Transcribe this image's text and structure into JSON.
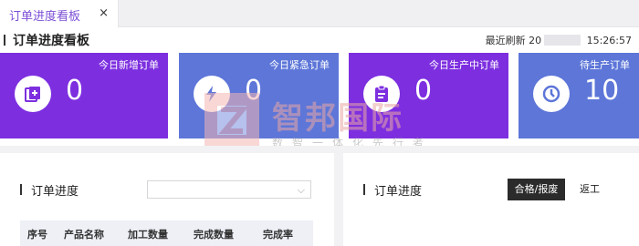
{
  "tab": {
    "label": "订单进度看板",
    "close": "×"
  },
  "header": {
    "title": "订单进度看板",
    "refresh_label": "最近刷新",
    "refresh_date_prefix": "20",
    "refresh_time": "15:26:57"
  },
  "kpis": [
    {
      "label": "今日新增订单",
      "value": "0",
      "icon": "add-document-icon",
      "color": "#7d2fe0"
    },
    {
      "label": "今日紧急订单",
      "value": "0",
      "icon": "lightning-icon",
      "color": "#5d76d8"
    },
    {
      "label": "今日生产中订单",
      "value": "0",
      "icon": "clipboard-icon",
      "color": "#7d2fe0"
    },
    {
      "label": "待生产订单",
      "value": "10",
      "icon": "clock-icon",
      "color": "#5d76d8"
    }
  ],
  "watermark": {
    "text": "智邦国际",
    "sub": "数智一体化先行者"
  },
  "left_panel": {
    "title": "订单进度",
    "select_value": "",
    "columns": [
      "序号",
      "产品名称",
      "加工数量",
      "完成数量",
      "完成率"
    ]
  },
  "right_panel": {
    "title": "订单进度",
    "buttons": [
      "合格/报废",
      "返工"
    ]
  }
}
